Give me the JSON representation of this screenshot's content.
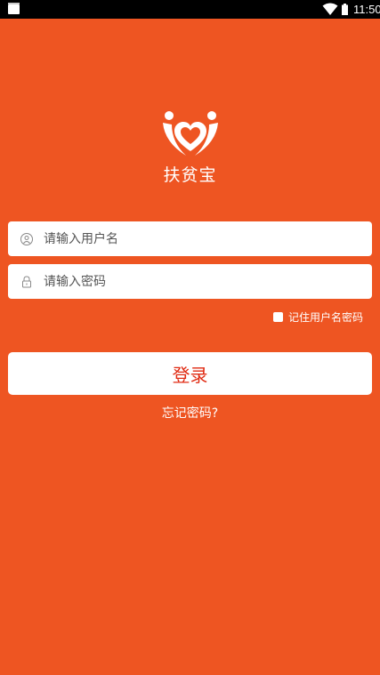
{
  "status_bar": {
    "time": "11:50",
    "icons": [
      "notification-icon",
      "wifi-icon",
      "battery-icon"
    ]
  },
  "brand": {
    "name": "扶贫宝",
    "logo_icon": "heart-hands-logo",
    "color": "#EE5522"
  },
  "login_form": {
    "username_placeholder": "请输入用户名",
    "username_value": "",
    "password_placeholder": "请输入密码",
    "password_value": "",
    "remember_label": "记住用户名密码",
    "remember_checked": false,
    "submit_label": "登录",
    "forgot_label": "忘记密码?"
  },
  "colors": {
    "background": "#EE5522",
    "button_text": "#E02A12"
  }
}
